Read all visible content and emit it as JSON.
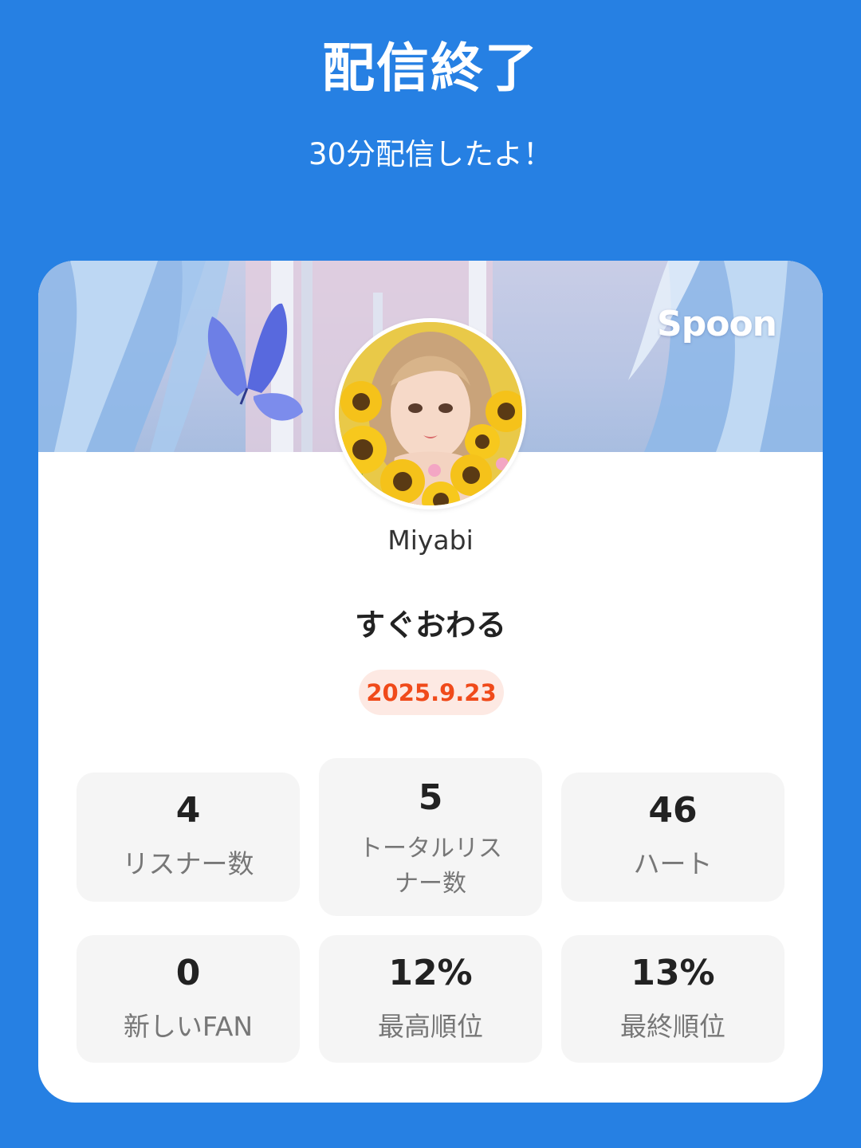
{
  "header": {
    "title": "配信終了",
    "subtitle": "30分配信したよ！"
  },
  "card": {
    "brand": "Spoon",
    "username": "Miyabi",
    "stream_title": "すぐおわる",
    "date": "2025.9.23"
  },
  "stats": [
    {
      "value": "4",
      "label": "リスナー数"
    },
    {
      "value": "5",
      "label": "トータルリスナー数"
    },
    {
      "value": "46",
      "label": "ハート"
    },
    {
      "value": "0",
      "label": "新しいFAN"
    },
    {
      "value": "12%",
      "label": "最高順位"
    },
    {
      "value": "13%",
      "label": "最終順位"
    }
  ],
  "colors": {
    "background": "#2680e3",
    "card": "#ffffff",
    "stat_box": "#f5f5f5",
    "date_text": "#f04a1a",
    "date_badge": "#fde9e3"
  },
  "icons": {
    "banner": "window-curtain-butterfly-illustration",
    "avatar": "girl-with-sunflowers-avatar"
  }
}
